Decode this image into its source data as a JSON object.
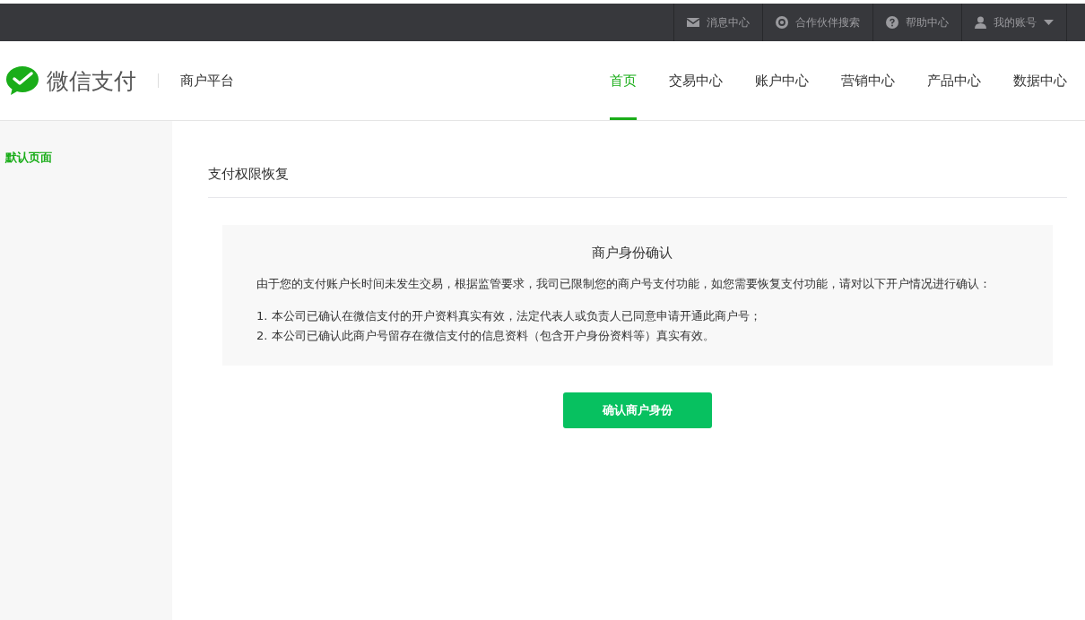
{
  "top_bar": {
    "links": [
      {
        "kind": "mail",
        "label": "消息中心"
      },
      {
        "kind": "search",
        "label": "合作伙伴搜索"
      },
      {
        "kind": "help",
        "label": "帮助中心"
      },
      {
        "kind": "user",
        "label": "我的账号",
        "dropdown": true
      }
    ]
  },
  "header": {
    "logo_text": "微信支付",
    "platform": "商户平台",
    "nav": [
      {
        "label": "首页",
        "selected": true
      },
      {
        "label": "交易中心",
        "selected": false
      },
      {
        "label": "账户中心",
        "selected": false
      },
      {
        "label": "营销中心",
        "selected": false
      },
      {
        "label": "产品中心",
        "selected": false
      },
      {
        "label": "数据中心",
        "selected": false
      }
    ]
  },
  "sidebar": {
    "items": [
      {
        "label": "默认页面",
        "selected": true
      }
    ]
  },
  "page": {
    "title": "支付权限恢复",
    "card": {
      "heading": "商户身份确认",
      "intro": "由于您的支付账户长时间未发生交易，根据监管要求，我司已限制您的商户号支付功能，如您需要恢复支付功能，请对以下开户情况进行确认：",
      "items": [
        "1. 本公司已确认在微信支付的开户资料真实有效，法定代表人或负责人已同意申请开通此商户号；",
        "2. 本公司已确认此商户号留存在微信支付的信息资料（包含开户身份资料等）真实有效。"
      ]
    },
    "button": "确认商户身份"
  }
}
